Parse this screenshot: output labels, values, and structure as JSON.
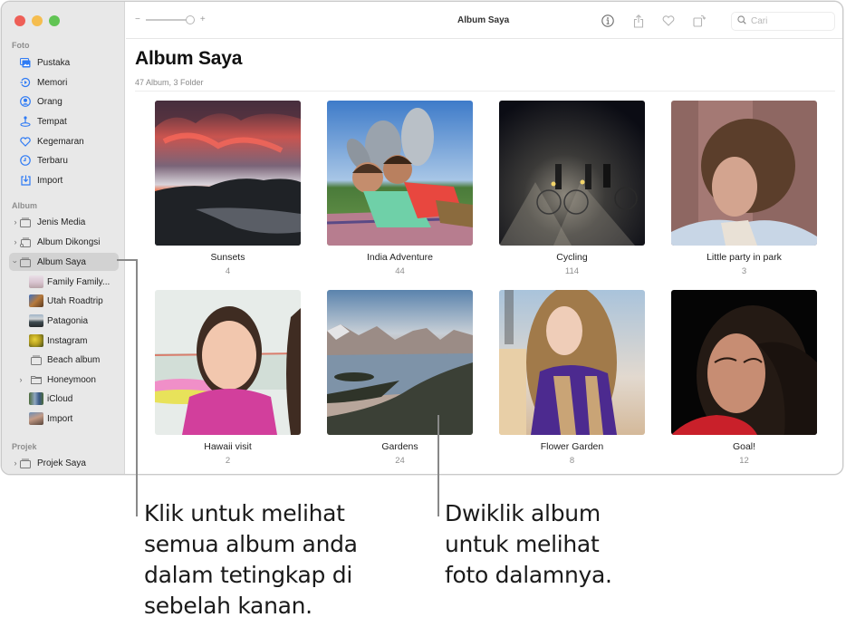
{
  "window": {
    "title": "Album Saya",
    "search_placeholder": "Cari",
    "zoom_minus": "−",
    "zoom_plus": "+",
    "zoom_level_fraction": 0.85
  },
  "sidebar": {
    "sections": {
      "foto": "Foto",
      "album": "Album",
      "projek": "Projek"
    },
    "foto_items": [
      {
        "label": "Pustaka",
        "icon": "library-icon"
      },
      {
        "label": "Memori",
        "icon": "memories-icon"
      },
      {
        "label": "Orang",
        "icon": "people-icon"
      },
      {
        "label": "Tempat",
        "icon": "places-icon"
      },
      {
        "label": "Kegemaran",
        "icon": "heart-icon"
      },
      {
        "label": "Terbaru",
        "icon": "clock-icon"
      },
      {
        "label": "Import",
        "icon": "import-icon"
      }
    ],
    "album_items": [
      {
        "label": "Jenis Media",
        "icon": "album-stack-icon",
        "expanded": false
      },
      {
        "label": "Album Dikongsi",
        "icon": "shared-album-icon",
        "expanded": false
      },
      {
        "label": "Album Saya",
        "icon": "album-stack-icon",
        "expanded": true,
        "selected": true
      }
    ],
    "my_albums": [
      {
        "label": "Family Family...",
        "icon": "album-thumbnail-icon"
      },
      {
        "label": "Utah Roadtrip",
        "icon": "album-thumbnail-icon"
      },
      {
        "label": "Patagonia",
        "icon": "album-thumbnail-icon"
      },
      {
        "label": "Instagram",
        "icon": "album-thumbnail-icon"
      },
      {
        "label": "Beach album",
        "icon": "empty-album-icon"
      },
      {
        "label": "Honeymoon",
        "icon": "folder-icon",
        "expanded": false
      },
      {
        "label": "iCloud",
        "icon": "album-thumbnail-icon"
      },
      {
        "label": "Import",
        "icon": "album-thumbnail-icon"
      }
    ],
    "project_items": [
      {
        "label": "Projek Saya",
        "icon": "album-stack-icon",
        "expanded": false
      }
    ]
  },
  "main": {
    "title": "Album Saya",
    "subtitle": "47 Album, 3 Folder",
    "albums": [
      {
        "name": "Sunsets",
        "count": "4"
      },
      {
        "name": "India Adventure",
        "count": "44"
      },
      {
        "name": "Cycling",
        "count": "114"
      },
      {
        "name": "Little party in park",
        "count": "3"
      },
      {
        "name": "Hawaii visit",
        "count": "2"
      },
      {
        "name": "Gardens",
        "count": "24"
      },
      {
        "name": "Flower Garden",
        "count": "8"
      },
      {
        "name": "Goal!",
        "count": "12"
      }
    ]
  },
  "callouts": {
    "left": [
      "Klik untuk melihat",
      "semua album anda",
      "dalam tetingkap di",
      "sebelah kanan."
    ],
    "right": [
      "Dwiklik album",
      "untuk melihat",
      "foto dalamnya."
    ]
  }
}
